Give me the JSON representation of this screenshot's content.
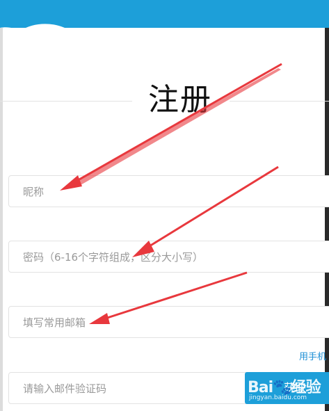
{
  "page": {
    "title": "注册",
    "fields": {
      "nickname_placeholder": "昵称",
      "password_placeholder": "密码（6-16个字符组成，区分大小写）",
      "email_placeholder": "填写常用邮箱",
      "verify_code_placeholder": "请输入邮件验证码"
    },
    "phone_link": "用手机",
    "get_code_button": "获取"
  },
  "watermark": {
    "logo_text": "Bai",
    "logo_suffix": "经验",
    "url": "jingyan.baidu.com"
  },
  "colors": {
    "header_blue": "#1d9fd9",
    "link_blue": "#1d8fd6",
    "arrow_red": "#e8383d"
  }
}
